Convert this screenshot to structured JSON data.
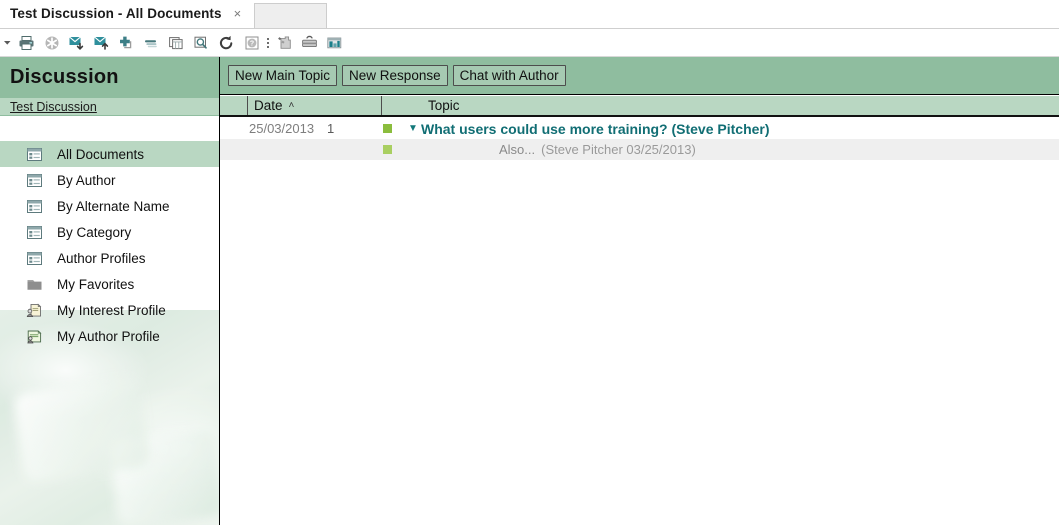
{
  "tab": {
    "title": "Test Discussion - All Documents",
    "close_label": "×"
  },
  "toolbar": {
    "icons": [
      {
        "name": "dropdown-arrow-icon",
        "label": "Dropdown"
      },
      {
        "name": "print-icon",
        "label": "Print"
      },
      {
        "name": "delete-icon",
        "label": "Delete"
      },
      {
        "name": "move-to-folder-icon",
        "label": "Move To Folder"
      },
      {
        "name": "copy-to-folder-icon",
        "label": "Copy To Folder"
      },
      {
        "name": "add-icon",
        "label": "Add"
      },
      {
        "name": "collapse-all-icon",
        "label": "Collapse All"
      },
      {
        "name": "expand-all-icon",
        "label": "Expand All"
      },
      {
        "name": "search-icon",
        "label": "Search"
      },
      {
        "name": "refresh-icon",
        "label": "Refresh"
      },
      {
        "name": "help-icon",
        "label": "Help"
      },
      {
        "name": "more-options-icon",
        "label": "More"
      },
      {
        "name": "tools-icon",
        "label": "Tools"
      },
      {
        "name": "toolbox-icon",
        "label": "Toolbox"
      },
      {
        "name": "chart-icon",
        "label": "Chart"
      }
    ]
  },
  "sidebar": {
    "title": "Discussion",
    "breadcrumb": "Test Discussion",
    "items": [
      {
        "label": "All Documents",
        "icon": "view-icon",
        "selected": true
      },
      {
        "label": "By Author",
        "icon": "view-icon",
        "selected": false
      },
      {
        "label": "By Alternate Name",
        "icon": "view-icon",
        "selected": false
      },
      {
        "label": "By Category",
        "icon": "view-icon",
        "selected": false
      },
      {
        "label": "Author Profiles",
        "icon": "view-icon",
        "selected": false
      },
      {
        "label": "My Favorites",
        "icon": "folder-icon",
        "selected": false
      },
      {
        "label": "My Interest Profile",
        "icon": "person-profile-icon",
        "selected": false
      },
      {
        "label": "My Author Profile",
        "icon": "person-form-icon",
        "selected": false
      }
    ]
  },
  "actions": {
    "new_main_topic": "New Main Topic",
    "new_response": "New Response",
    "chat_with_author": "Chat with Author"
  },
  "table": {
    "columns": {
      "date": "Date",
      "sort_caret": "˄",
      "topic": "Topic"
    },
    "rows": [
      {
        "type": "main",
        "date": "25/03/2013",
        "count": "1",
        "twisty": "▼",
        "topic": "What users could use more training? (Steve Pitcher)"
      },
      {
        "type": "sub",
        "date": "",
        "count": "",
        "twisty": "",
        "topic": "Also...",
        "meta": "(Steve Pitcher 03/25/2013)"
      }
    ]
  },
  "colors": {
    "header_green": "#8fbd9f",
    "light_green": "#b9d7c2",
    "link_teal": "#116e74",
    "marker_green": "#8bbd3d",
    "row_alt": "#efefef"
  }
}
